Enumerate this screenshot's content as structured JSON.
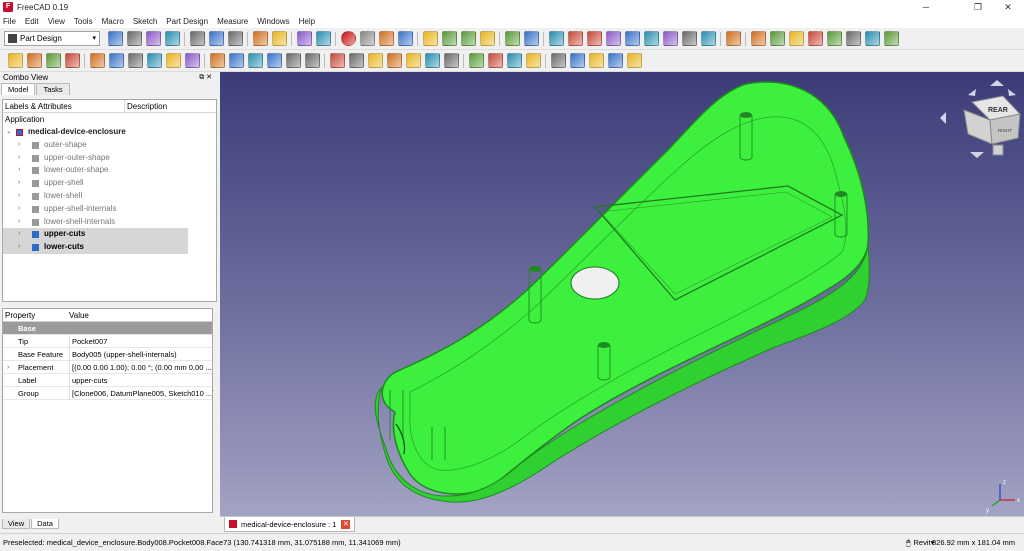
{
  "window": {
    "app_title": "FreeCAD 0.19",
    "minimize": "─",
    "restore": "❐",
    "close": "✕"
  },
  "menu": [
    "File",
    "Edit",
    "View",
    "Tools",
    "Macro",
    "Sketch",
    "Part Design",
    "Measure",
    "Windows",
    "Help"
  ],
  "workbench": {
    "selected": "Part Design"
  },
  "combo_view": {
    "title": "Combo View",
    "tabs": [
      "Model",
      "Tasks"
    ],
    "tree_columns": [
      "Labels & Attributes",
      "Description"
    ],
    "root_label": "Application",
    "document": "medical-device-enclosure",
    "items": [
      {
        "label": "outer-shape",
        "active": false
      },
      {
        "label": "upper-outer-shape",
        "active": false
      },
      {
        "label": "lower-outer-shape",
        "active": false
      },
      {
        "label": "upper-shell",
        "active": false
      },
      {
        "label": "lower-shell",
        "active": false
      },
      {
        "label": "upper-shell-internals",
        "active": false
      },
      {
        "label": "lower-shell-internals",
        "active": false
      },
      {
        "label": "upper-cuts",
        "active": true
      },
      {
        "label": "lower-cuts",
        "active": true
      }
    ],
    "property_columns": [
      "Property",
      "Value"
    ],
    "properties": [
      {
        "group": "Base"
      },
      {
        "name": "Tip",
        "value": "Pocket007"
      },
      {
        "name": "Base Feature",
        "value": "Body005 (upper-shell-internals)"
      },
      {
        "name": "Placement",
        "value": "[(0.00 0.00 1.00); 0.00 °; (0.00 mm  0.00 ...",
        "expandable": true
      },
      {
        "name": "Label",
        "value": "upper-cuts"
      },
      {
        "name": "Group",
        "value": "[Clone006, DatumPlane005, Sketch010 ...]"
      }
    ],
    "bottom_tabs": [
      "View",
      "Data"
    ]
  },
  "document_tab": {
    "label": "medical-device-enclosure : 1"
  },
  "navcube": {
    "face_label": "REAR",
    "side_label": "RIGHT"
  },
  "axis": {
    "x": "x",
    "y": "y",
    "z": "z"
  },
  "statusbar": {
    "preselected": "Preselected: medical_device_enclosure.Body008.Pocket008.Face73 (130.741318 mm, 31.075188 mm, 11.341069 mm)",
    "nav_style": "Revit",
    "dimensions": "326.92 mm x 181.04 mm"
  },
  "colors": {
    "model_green": "#3df03d",
    "model_edge": "#1f8a1f",
    "viewport_top": "#3b3b78",
    "viewport_bottom": "#a3a3c5",
    "record": "#cc1111"
  },
  "toolbar_icons": {
    "row1": [
      "new-icon",
      "open-icon",
      "save-icon",
      "save-as-icon",
      "cut-icon",
      "copy-icon",
      "paste-icon",
      "undo-icon",
      "redo-icon",
      "refresh-icon",
      "whats-this-icon",
      "macro-record-icon",
      "macro-stop-icon",
      "macro-edit-icon",
      "macro-run-icon",
      "fit-all-icon",
      "fit-selection-icon",
      "draw-style-icon",
      "stereo-icon",
      "back-icon",
      "forward-icon",
      "std-views-icon",
      "zoom-icon",
      "isometric-icon",
      "front-view-icon",
      "top-view-icon",
      "right-view-icon",
      "rear-view-icon",
      "bottom-view-icon",
      "left-view-icon",
      "measure-icon",
      "part-icon",
      "group-icon",
      "link-make-icon",
      "link-sub-icon",
      "link-actions-icon",
      "link-select-icon",
      "link-goto-icon",
      "link-import-icon"
    ],
    "row2": [
      "body-icon",
      "sketch-icon",
      "validate-sketch-icon",
      "clone-icon",
      "point-icon",
      "line-icon",
      "plane-icon",
      "lcs-icon",
      "shape-binder-icon",
      "subshape-binder-icon",
      "pad-icon",
      "revolution-icon",
      "loft-icon",
      "pipe-icon",
      "helix-icon",
      "additive-primitive-icon",
      "pocket-icon",
      "hole-icon",
      "groove-icon",
      "subtractive-loft-icon",
      "subtractive-pipe-icon",
      "subtractive-helix-icon",
      "subtractive-primitive-icon",
      "mirrored-icon",
      "linear-pattern-icon",
      "polar-pattern-icon",
      "multitransform-icon",
      "fillet-icon",
      "chamfer-icon",
      "draft-icon",
      "thickness-icon",
      "boolean-icon"
    ]
  }
}
